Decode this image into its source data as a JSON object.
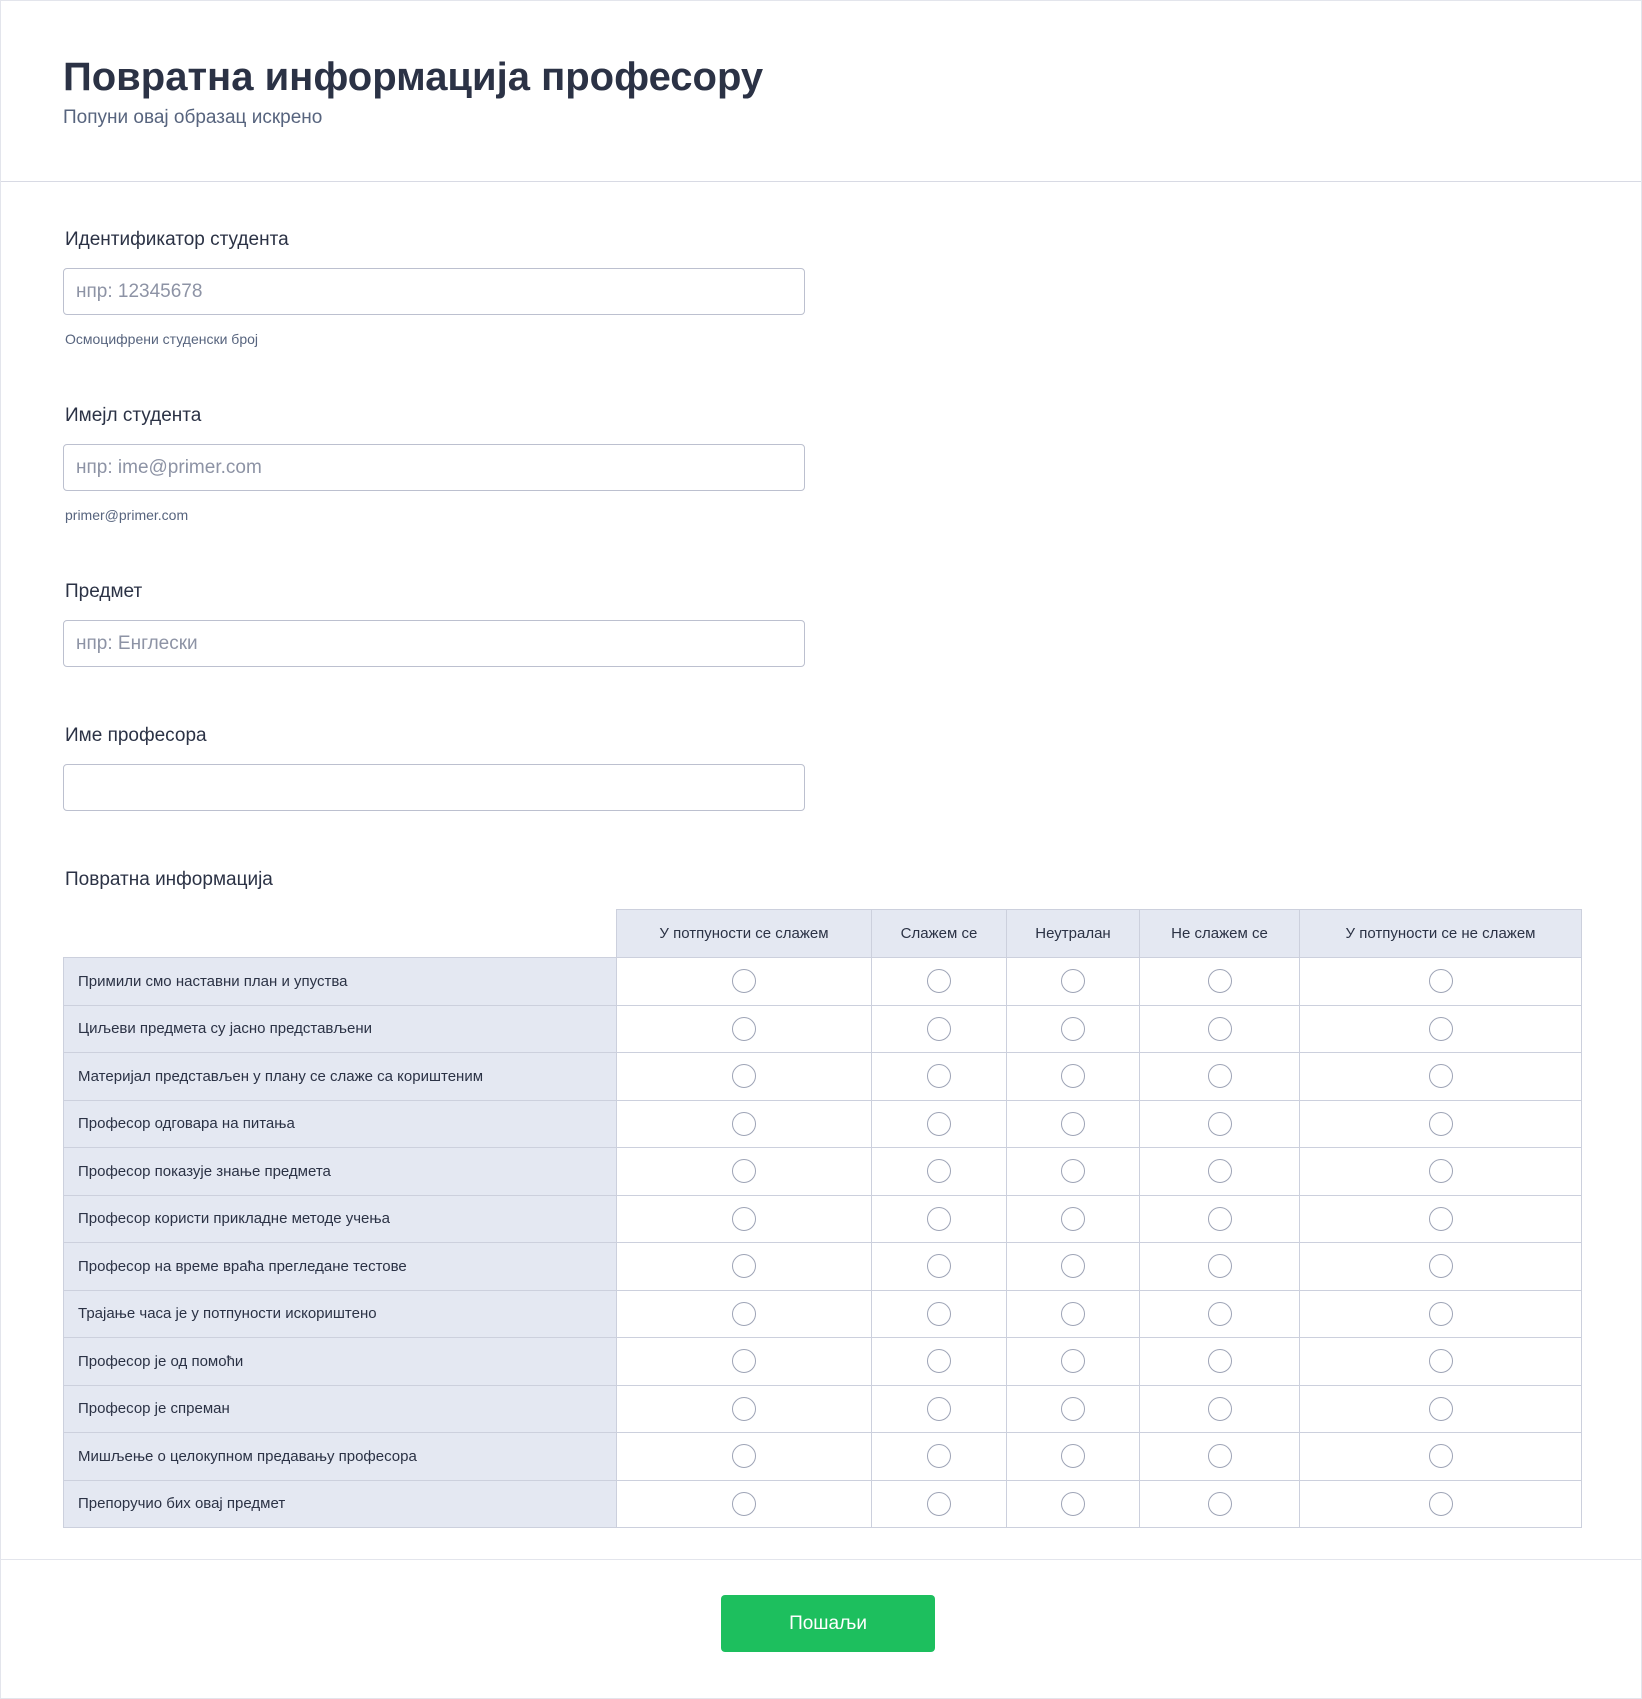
{
  "header": {
    "title": "Повратна информација професору",
    "subtitle": "Попуни овај образац искрено"
  },
  "fields": {
    "student_id": {
      "label": "Идентификатор студента",
      "placeholder": "нпр: 12345678",
      "value": "",
      "sublabel": "Осмоцифрени студенски број"
    },
    "student_email": {
      "label": "Имејл студента",
      "placeholder": "нпр: ime@primer.com",
      "value": "",
      "sublabel": "primer@primer.com"
    },
    "subject": {
      "label": "Предмет",
      "placeholder": "нпр: Енглески",
      "value": ""
    },
    "professor_name": {
      "label": "Име професора",
      "placeholder": "",
      "value": ""
    }
  },
  "matrix": {
    "label": "Повратна информација",
    "columns": [
      "У потпуности се слажем",
      "Слажем се",
      "Неутралан",
      "Не слажем се",
      "У потпуности се не слажем"
    ],
    "rows": [
      "Примили смо наставни план и упуства",
      "Циљеви предмета су јасно представљени",
      "Материјал представљен у плану се слаже са кориштеним",
      "Професор одговара на питања",
      "Професор показује знање предмета",
      "Професор користи прикладне методе учења",
      "Професор на време враћа прегледане тестове",
      "Трајање часа је у потпуности искориштено",
      "Професор је од помоћи",
      "Професор је спреман",
      "Мишљење о целокупном предавању професора",
      "Препоручио бих овај предмет"
    ]
  },
  "footer": {
    "submit_label": "Пошаљи"
  },
  "colors": {
    "accent": "#1dbf5e",
    "header_cell_bg": "#e4e8f2",
    "text": "#2b3245"
  }
}
